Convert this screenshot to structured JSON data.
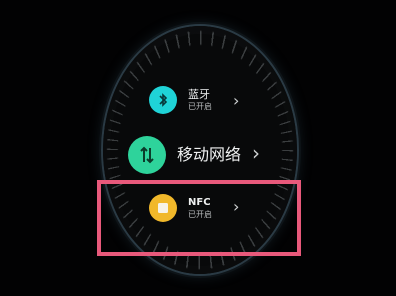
{
  "watch": {
    "items": [
      {
        "title": "蓝牙",
        "subtitle": "已开启",
        "icon": "bluetooth-icon",
        "color": "#1fd3d7"
      },
      {
        "title": "移动网络",
        "subtitle": "",
        "icon": "mobile-network-icon",
        "color": "#2ed39b"
      },
      {
        "title": "NFC",
        "subtitle": "已开启",
        "icon": "nfc-card-icon",
        "color": "#f1b82a"
      }
    ],
    "chevron": "›"
  },
  "highlight_color": "#e8597b"
}
